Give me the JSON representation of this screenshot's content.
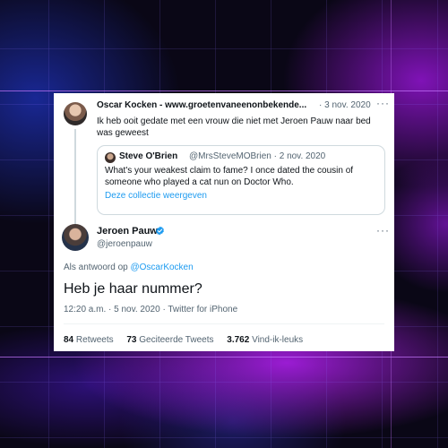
{
  "parent_tweet": {
    "author_name": "Oscar Kocken - www.groetenvaneenonbekende...",
    "time": "· 3 nov. 2020",
    "text": "Ik heb ooit gedate met een vrouw die niet met Jeroen Pauw naar bed was geweest",
    "more_label": "···",
    "quote": {
      "author_name": "Steve O'Brien",
      "handle_time": "@MrsSteveMOBrien · 2 nov. 2020",
      "text": "What's your weakest claim to fame? I once dated the cousin of someone who played a cat nun on Doctor Who.",
      "link": "Deze collectie weergeven"
    }
  },
  "main_tweet": {
    "author_name": "Jeroen Pauw",
    "handle": "@jeroenpauw",
    "more_label": "···",
    "reply_prefix": "Als antwoord op",
    "reply_to": "@OscarKocken",
    "text": "Heb je haar nummer?",
    "meta": "12:20 a.m. · 5 nov. 2020 · Twitter for iPhone",
    "stats": [
      {
        "value": "84",
        "label": "Retweets"
      },
      {
        "value": "73",
        "label": "Geciteerde Tweets"
      },
      {
        "value": "3.762",
        "label": "Vind-ik-leuks"
      }
    ]
  },
  "colors": {
    "link_blue": "#1d9bf0",
    "muted_text": "#536471",
    "text": "#0f1419",
    "verified_badge": "#1d9bf0"
  },
  "icons": [
    "verified-badge-icon",
    "more-options-icon"
  ]
}
